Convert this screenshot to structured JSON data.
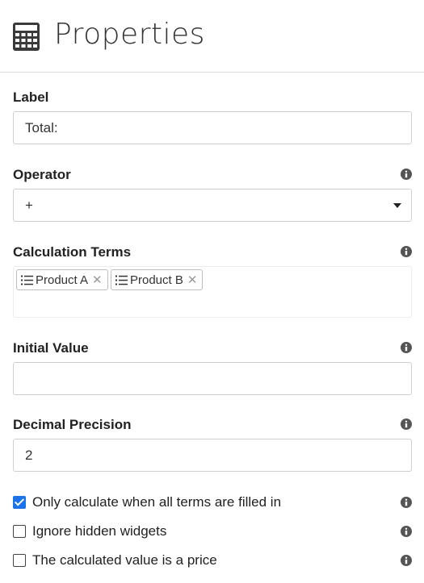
{
  "header": {
    "title": "Properties",
    "icon": "calculator-icon"
  },
  "label_field": {
    "label": "Label",
    "value": "Total:"
  },
  "operator_field": {
    "label": "Operator",
    "value": "+"
  },
  "terms_field": {
    "label": "Calculation Terms",
    "tags": [
      {
        "label": "Product A",
        "icon": "list-icon"
      },
      {
        "label": "Product B",
        "icon": "list-icon"
      }
    ]
  },
  "initial_value_field": {
    "label": "Initial Value",
    "value": ""
  },
  "decimal_field": {
    "label": "Decimal Precision",
    "value": "2"
  },
  "options": [
    {
      "label": "Only calculate when all terms are filled in",
      "checked": true
    },
    {
      "label": "Ignore hidden widgets",
      "checked": false
    },
    {
      "label": "The calculated value is a price",
      "checked": false
    }
  ],
  "colors": {
    "accent": "#1a73e8",
    "border": "#cfcfcf"
  }
}
